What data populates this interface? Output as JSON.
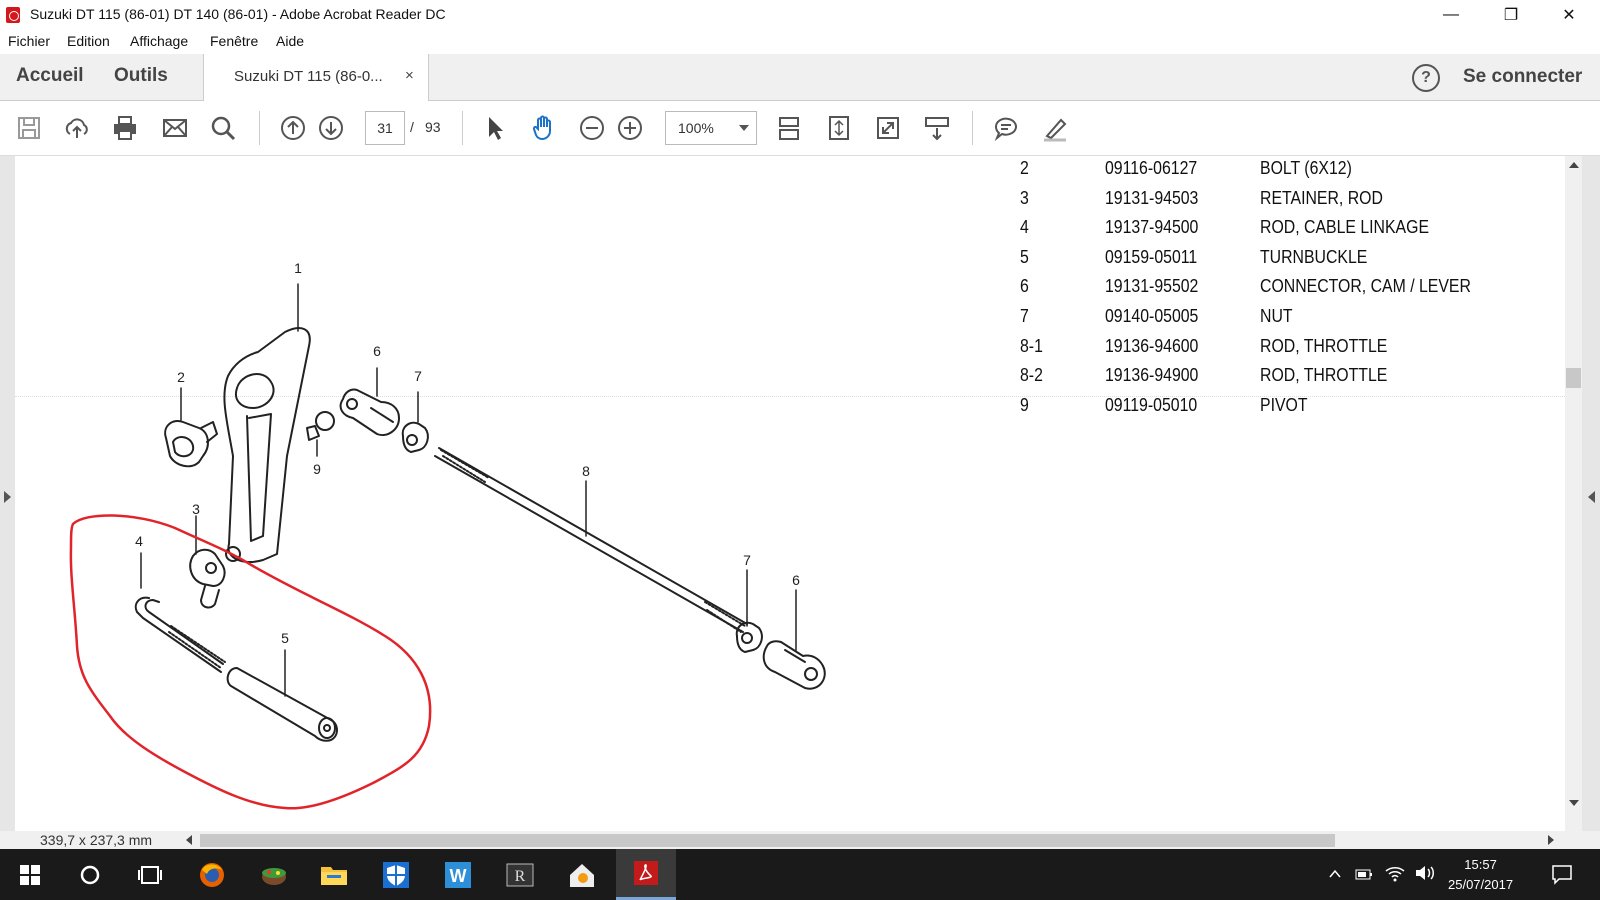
{
  "window": {
    "title": "Suzuki DT 115 (86-01) DT 140 (86-01) - Adobe Acrobat Reader DC",
    "controls": {
      "minimize": "—",
      "restore": "❐",
      "close": "✕"
    }
  },
  "menu": [
    "Fichier",
    "Edition",
    "Affichage",
    "Fenêtre",
    "Aide"
  ],
  "tabs": {
    "home": "Accueil",
    "tools": "Outils",
    "document": "Suzuki DT 115 (86-0...",
    "close": "×",
    "help": "?",
    "login": "Se connecter"
  },
  "toolbar": {
    "page_current": "31",
    "page_sep": "/",
    "page_total": "93",
    "zoom": "100%"
  },
  "parts": [
    {
      "ref": "2",
      "part_no": "09116-06127",
      "desc": "BOLT (6X12)"
    },
    {
      "ref": "3",
      "part_no": "19131-94503",
      "desc": "RETAINER, ROD"
    },
    {
      "ref": "4",
      "part_no": "19137-94500",
      "desc": "ROD, CABLE LINKAGE"
    },
    {
      "ref": "5",
      "part_no": "09159-05011",
      "desc": "TURNBUCKLE"
    },
    {
      "ref": "6",
      "part_no": "19131-95502",
      "desc": "CONNECTOR, CAM / LEVER"
    },
    {
      "ref": "7",
      "part_no": "09140-05005",
      "desc": "NUT"
    },
    {
      "ref": "8-1",
      "part_no": "19136-94600",
      "desc": "ROD, THROTTLE"
    },
    {
      "ref": "8-2",
      "part_no": "19136-94900",
      "desc": "ROD, THROTTLE"
    },
    {
      "ref": "9",
      "part_no": "09119-05010",
      "desc": "PIVOT"
    }
  ],
  "diagram": {
    "callouts": {
      "c1": "1",
      "c2": "2",
      "c3": "3",
      "c4": "4",
      "c5": "5",
      "c6a": "6",
      "c6b": "6",
      "c7a": "7",
      "c7b": "7",
      "c8": "8",
      "c9": "9"
    },
    "annotation_color": "#e0242a"
  },
  "status": {
    "dimensions": "339,7 x 237,3 mm"
  },
  "taskbar": {
    "time": "15:57",
    "date": "25/07/2017"
  }
}
